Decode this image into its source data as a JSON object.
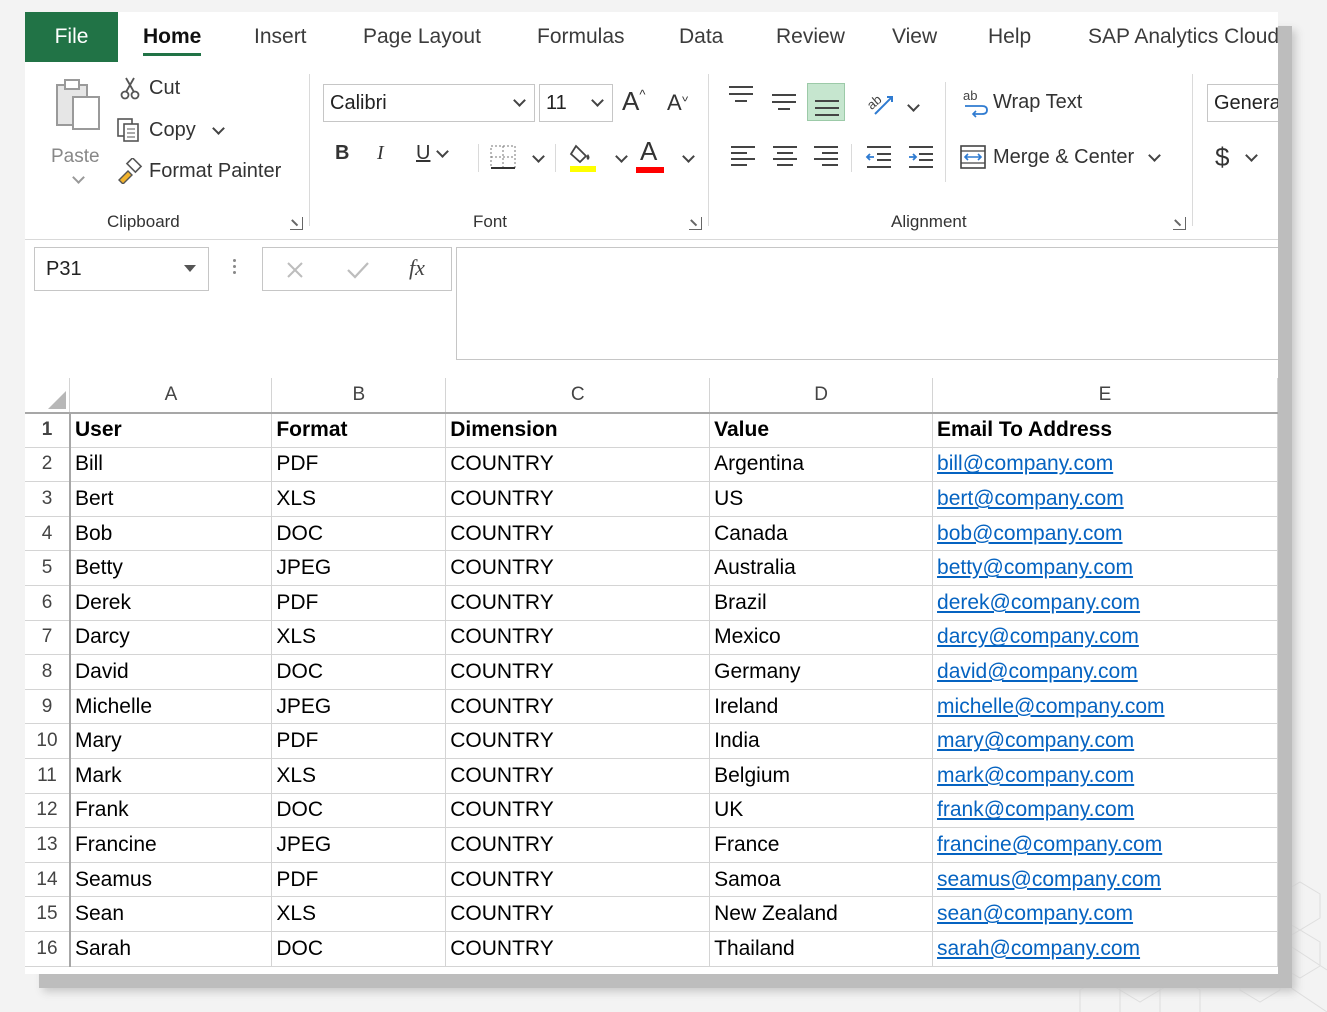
{
  "tabs": [
    "File",
    "Home",
    "Insert",
    "Page Layout",
    "Formulas",
    "Data",
    "Review",
    "View",
    "Help",
    "SAP Analytics Cloud"
  ],
  "active_tab": "Home",
  "clipboard": {
    "paste_label": "Paste",
    "cut_label": "Cut",
    "copy_label": "Copy",
    "format_painter_label": "Format Painter",
    "group_label": "Clipboard"
  },
  "font": {
    "family": "Calibri",
    "size": "11",
    "grow_label": "A",
    "shrink_label": "A",
    "bold_label": "B",
    "italic_label": "I",
    "underline_label": "U",
    "font_color_letter": "A",
    "group_label": "Font",
    "highlight_color": "#ffff00",
    "font_color": "#ff0000"
  },
  "alignment": {
    "wrap_text_label": "Wrap Text",
    "merge_center_label": "Merge & Center",
    "group_label": "Alignment"
  },
  "number": {
    "format_value": "Genera",
    "currency_symbol": "$"
  },
  "formula_bar": {
    "name_box": "P31",
    "fx_label": "fx",
    "formula": ""
  },
  "sheet": {
    "columns": [
      "A",
      "B",
      "C",
      "D",
      "E"
    ],
    "header": [
      "User",
      "Format",
      "Dimension",
      "Value",
      "Email To Address"
    ],
    "rows": [
      [
        "Bill",
        "PDF",
        "COUNTRY",
        "Argentina",
        "bill@company.com"
      ],
      [
        "Bert",
        "XLS",
        "COUNTRY",
        "US",
        "bert@company.com"
      ],
      [
        "Bob",
        "DOC",
        "COUNTRY",
        "Canada",
        "bob@company.com"
      ],
      [
        "Betty",
        "JPEG",
        "COUNTRY",
        "Australia",
        "betty@company.com"
      ],
      [
        "Derek",
        "PDF",
        "COUNTRY",
        "Brazil",
        "derek@company.com"
      ],
      [
        "Darcy",
        "XLS",
        "COUNTRY",
        "Mexico",
        "darcy@company.com"
      ],
      [
        "David",
        "DOC",
        "COUNTRY",
        "Germany",
        "david@company.com"
      ],
      [
        "Michelle",
        "JPEG",
        "COUNTRY",
        "Ireland",
        "michelle@company.com"
      ],
      [
        "Mary",
        "PDF",
        "COUNTRY",
        "India",
        "mary@company.com"
      ],
      [
        "Mark",
        "XLS",
        "COUNTRY",
        "Belgium",
        "mark@company.com"
      ],
      [
        "Frank",
        "DOC",
        "COUNTRY",
        "UK",
        "frank@company.com"
      ],
      [
        "Francine",
        "JPEG",
        "COUNTRY",
        "France",
        "francine@company.com"
      ],
      [
        "Seamus",
        "PDF",
        "COUNTRY",
        "Samoa",
        "seamus@company.com"
      ],
      [
        "Sean",
        "XLS",
        "COUNTRY",
        "New Zealand",
        "sean@company.com"
      ],
      [
        "Sarah",
        "DOC",
        "COUNTRY",
        "Thailand",
        "sarah@company.com"
      ]
    ],
    "link_color": "#0563c1"
  },
  "colors": {
    "file_tab": "#217346",
    "accent": "#217346"
  }
}
